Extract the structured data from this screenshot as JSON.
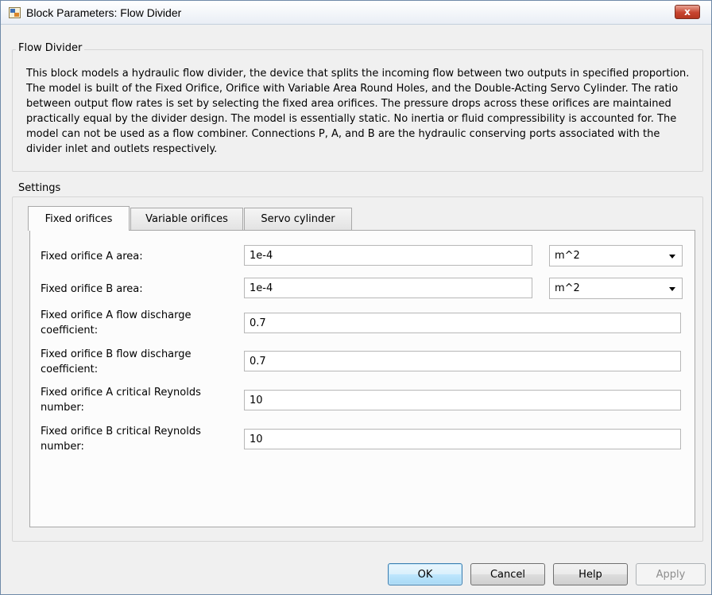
{
  "window": {
    "title": "Block Parameters: Flow Divider",
    "close_glyph": "x"
  },
  "block_group": {
    "label": "Flow Divider",
    "description": "This block models a hydraulic flow divider, the device that splits the incoming flow between two outputs in specified proportion. The model is built of the Fixed Orifice, Orifice with Variable Area Round Holes, and the Double-Acting Servo Cylinder. The ratio between output flow rates is set by selecting the fixed area orifices. The pressure drops across these orifices are maintained practically equal by the divider design. The model is essentially static. No inertia or fluid compressibility is accounted for. The model can not be used as a flow combiner. Connections P, A, and B are the hydraulic conserving ports associated with the divider inlet and outlets respectively."
  },
  "settings": {
    "label": "Settings",
    "tabs": [
      {
        "label": "Fixed orifices",
        "active": true
      },
      {
        "label": "Variable orifices",
        "active": false
      },
      {
        "label": "Servo cylinder",
        "active": false
      }
    ],
    "params": [
      {
        "label": "Fixed orifice A area:",
        "value": "1e-4",
        "unit": "m^2"
      },
      {
        "label": "Fixed orifice B area:",
        "value": "1e-4",
        "unit": "m^2"
      },
      {
        "label": "Fixed orifice A flow discharge coefficient:",
        "value": "0.7"
      },
      {
        "label": "Fixed orifice B flow discharge coefficient:",
        "value": "0.7"
      },
      {
        "label": "Fixed orifice A critical Reynolds number:",
        "value": "10"
      },
      {
        "label": "Fixed orifice B critical Reynolds number:",
        "value": "10"
      }
    ]
  },
  "buttons": {
    "ok": "OK",
    "cancel": "Cancel",
    "help": "Help",
    "apply": "Apply"
  },
  "colors": {
    "close_button": "#c7442f",
    "default_button_border": "#3c7fb1",
    "window_background": "#f0f0f0"
  },
  "icons": {
    "app": "simulink-block-icon",
    "close": "close-icon",
    "dropdown": "chevron-down-icon"
  }
}
